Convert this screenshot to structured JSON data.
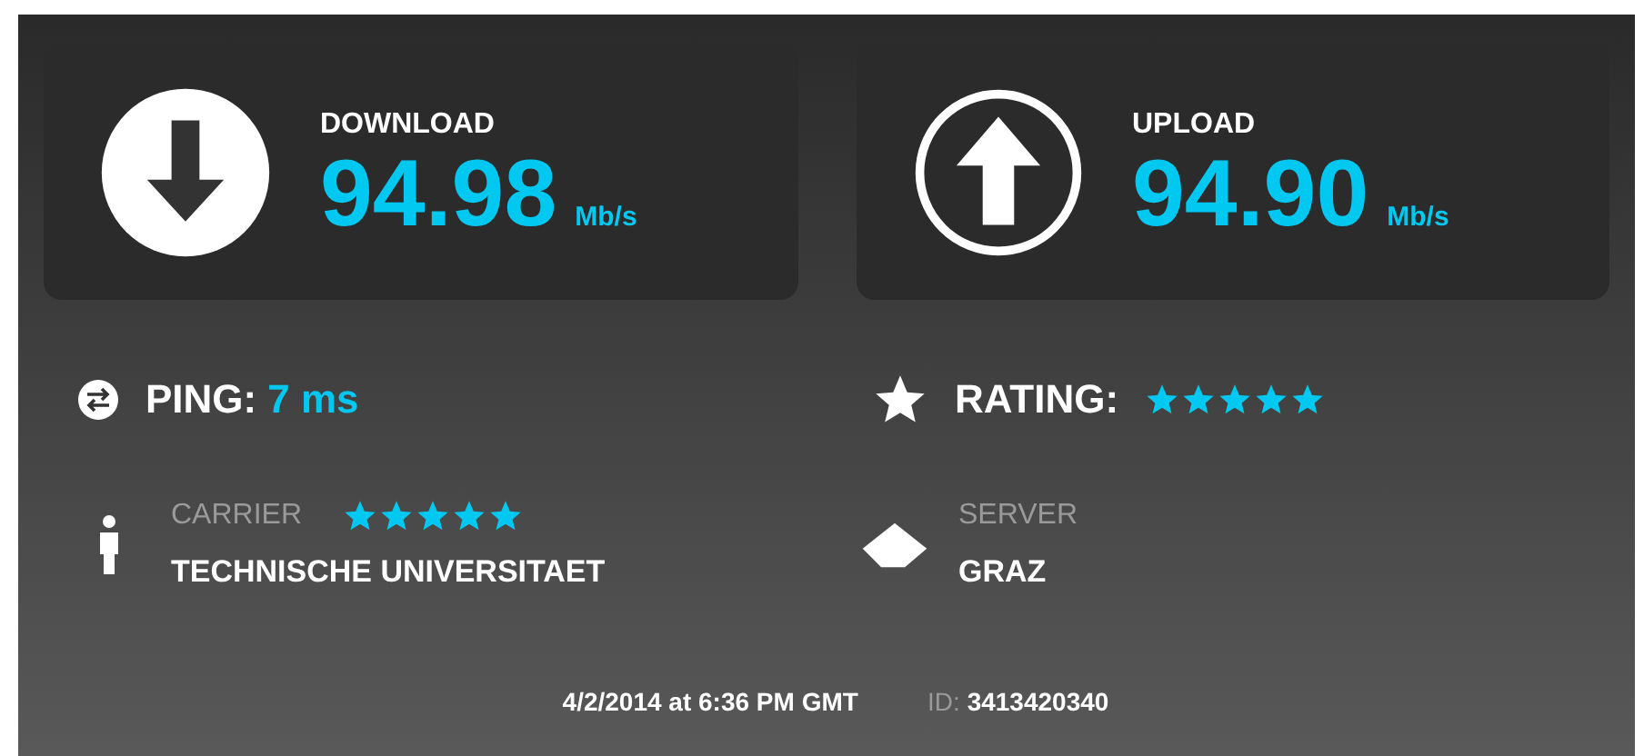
{
  "results": [
    {
      "kind": "download",
      "label": "DOWNLOAD",
      "value": "94.98",
      "unit": "Mb/s"
    },
    {
      "kind": "upload",
      "label": "UPLOAD",
      "value": "94.90",
      "unit": "Mb/s"
    }
  ],
  "ping": {
    "label": "PING:",
    "value": "7 ms"
  },
  "rating": {
    "label": "RATING:",
    "stars": 5
  },
  "carrier": {
    "label": "CARRIER",
    "stars": 5,
    "name": "TECHNISCHE UNIVERSITAET"
  },
  "server": {
    "label": "SERVER",
    "name": "GRAZ"
  },
  "footer": {
    "date": "4/2/2014 at 6:36 PM GMT",
    "id_label": "ID:",
    "id": "3413420340"
  }
}
